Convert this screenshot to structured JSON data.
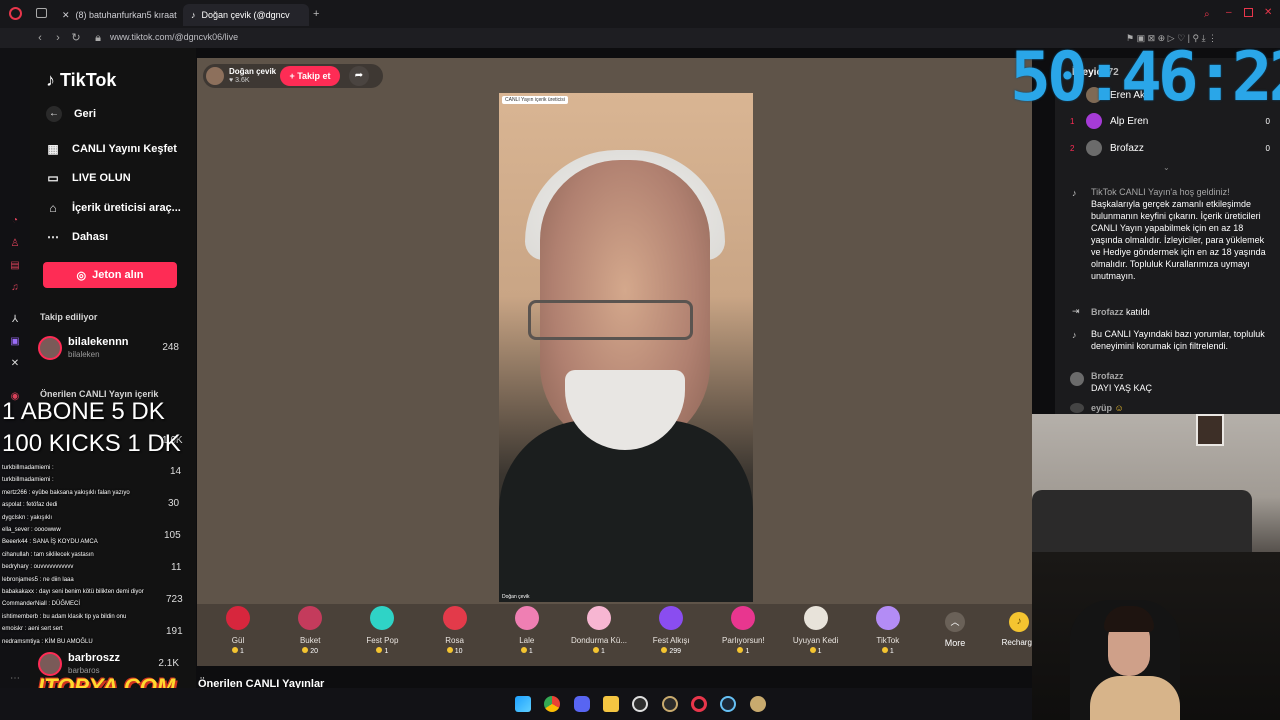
{
  "browser": {
    "tabs": [
      {
        "label": "(8) batuhanfurkan5 kıraat"
      },
      {
        "label": "Doğan çevik (@dgncv"
      }
    ],
    "new_tab": "+",
    "url": "www.tiktok.com/@dgncvk06/live"
  },
  "sidebar": {
    "logo": "TikTok",
    "items": [
      {
        "label": "Geri",
        "icon": "back-arrow-icon"
      },
      {
        "label": "CANLI Yayını Keşfet",
        "icon": "calendar-icon"
      },
      {
        "label": "LIVE OLUN",
        "icon": "camera-icon"
      },
      {
        "label": "İçerik üreticisi araç...",
        "icon": "house-icon"
      },
      {
        "label": "Dahası",
        "icon": "more-icon"
      }
    ],
    "coin_button": "Jeton alın",
    "following_title": "Takip ediliyor",
    "following": [
      {
        "name": "bilalekennn",
        "handle": "bilaleken",
        "count": "248"
      }
    ],
    "suggested_title": "Önerilen CANLI Yayın içerik",
    "suggested_counts": [
      "1.6K",
      "14",
      "30",
      "105",
      "11",
      "723",
      "191"
    ],
    "bottom_account": {
      "name": "barbroszz",
      "handle": "barbaros",
      "count": "2.1K"
    }
  },
  "stream": {
    "host_name": "Doğan çevik",
    "host_likes": "3.6K",
    "follow_label": "+ Takip et",
    "video_label": "CANLI Yayın içerik üreticisi",
    "video_name": "Doğan çevik"
  },
  "gifts": [
    {
      "name": "Gül",
      "price": "1",
      "color": "#d7263d"
    },
    {
      "name": "Buket",
      "price": "20",
      "color": "#c43b5c"
    },
    {
      "name": "Fest Pop",
      "price": "1",
      "color": "#2fd3c6"
    },
    {
      "name": "Rosa",
      "price": "10",
      "color": "#e33a4a"
    },
    {
      "name": "Lale",
      "price": "1",
      "color": "#ef7fb3"
    },
    {
      "name": "Dondurma Kü...",
      "price": "1",
      "color": "#f7b6d2"
    },
    {
      "name": "Fest Alkışı",
      "price": "299",
      "color": "#8a4df0"
    },
    {
      "name": "Parlıyorsun!",
      "price": "1",
      "color": "#e8368f"
    },
    {
      "name": "Uyuyan Kedi",
      "price": "1",
      "color": "#e8e3da"
    },
    {
      "name": "TikTok",
      "price": "1",
      "color": "#b38cf5"
    }
  ],
  "more_label": "More",
  "recharge_label": "Recharge",
  "suggested_lives": "Önerilen CANLI Yayınlar",
  "chat_panel": {
    "viewers_header": "İzleyici",
    "viewers_count": "72",
    "ranking": [
      {
        "rank": "",
        "name": "Eren Akıc",
        "score": ""
      },
      {
        "rank": "1",
        "name": "Alp Eren",
        "score": "0"
      },
      {
        "rank": "2",
        "name": "Brofazz",
        "score": "0"
      }
    ],
    "welcome_title": "TikTok CANLI Yayın'a hoş geldiniz!",
    "welcome_body": "Başkalarıyla gerçek zamanlı etkileşimde bulunmanın keyfini çıkarın. İçerik üreticileri CANLI Yayın yapabilmek için en az 18 yaşında olmalıdır. İzleyiciler, para yüklemek ve Hediye göndermek için en az 18 yaşında olmalıdır. Topluluk Kurallarımıza uymayı unutmayın.",
    "join_user": "Brofazz",
    "join_text": "katıldı",
    "moderation_note": "Bu CANLI Yayındaki bazı yorumlar, topluluk deneyimini korumak için filtrelendi.",
    "messages": [
      {
        "user": "Brofazz",
        "text": "DAYI YAŞ KAÇ"
      },
      {
        "user": "eyüp",
        "text": ""
      }
    ]
  },
  "overlay": {
    "timer": "50:46:22",
    "line1": "1 ABONE 5 DK",
    "line2": "100 KICKS  1 DK",
    "brand": "ITOPYA.COM",
    "kick_chat": [
      "turkbillmadamiemi :",
      "turkbillmadamiemi :",
      "mertz266 : eyübe baksana yakışıklı falan yazıyo",
      "aspolat : fetöfaz dedi",
      "dygclskn : yakışıklı",
      "ella_sever : oooowww",
      "Beeerk44 : SANA İŞ KOYDU AMCA",
      "cihanullah : tam siklilecek yastasın",
      "bedryhary : ouvvvvvvvvvvv",
      "lebronjames5 : ne diin laaa",
      "babakakaxx : dayı seni benim kötü bilikten demi diyor",
      "CommanderNiall : DÜĞMECİ",
      "ishtimemberb : bu adam klasik tip ya bildin onu",
      "emoiskr : aeni sert sert",
      "nedramsmtiya : KİM BU AMOĞLU"
    ]
  },
  "colors": {
    "accent": "#fe2c55",
    "timer": "#2aa6e8",
    "stage_bg": "#5f5449"
  }
}
